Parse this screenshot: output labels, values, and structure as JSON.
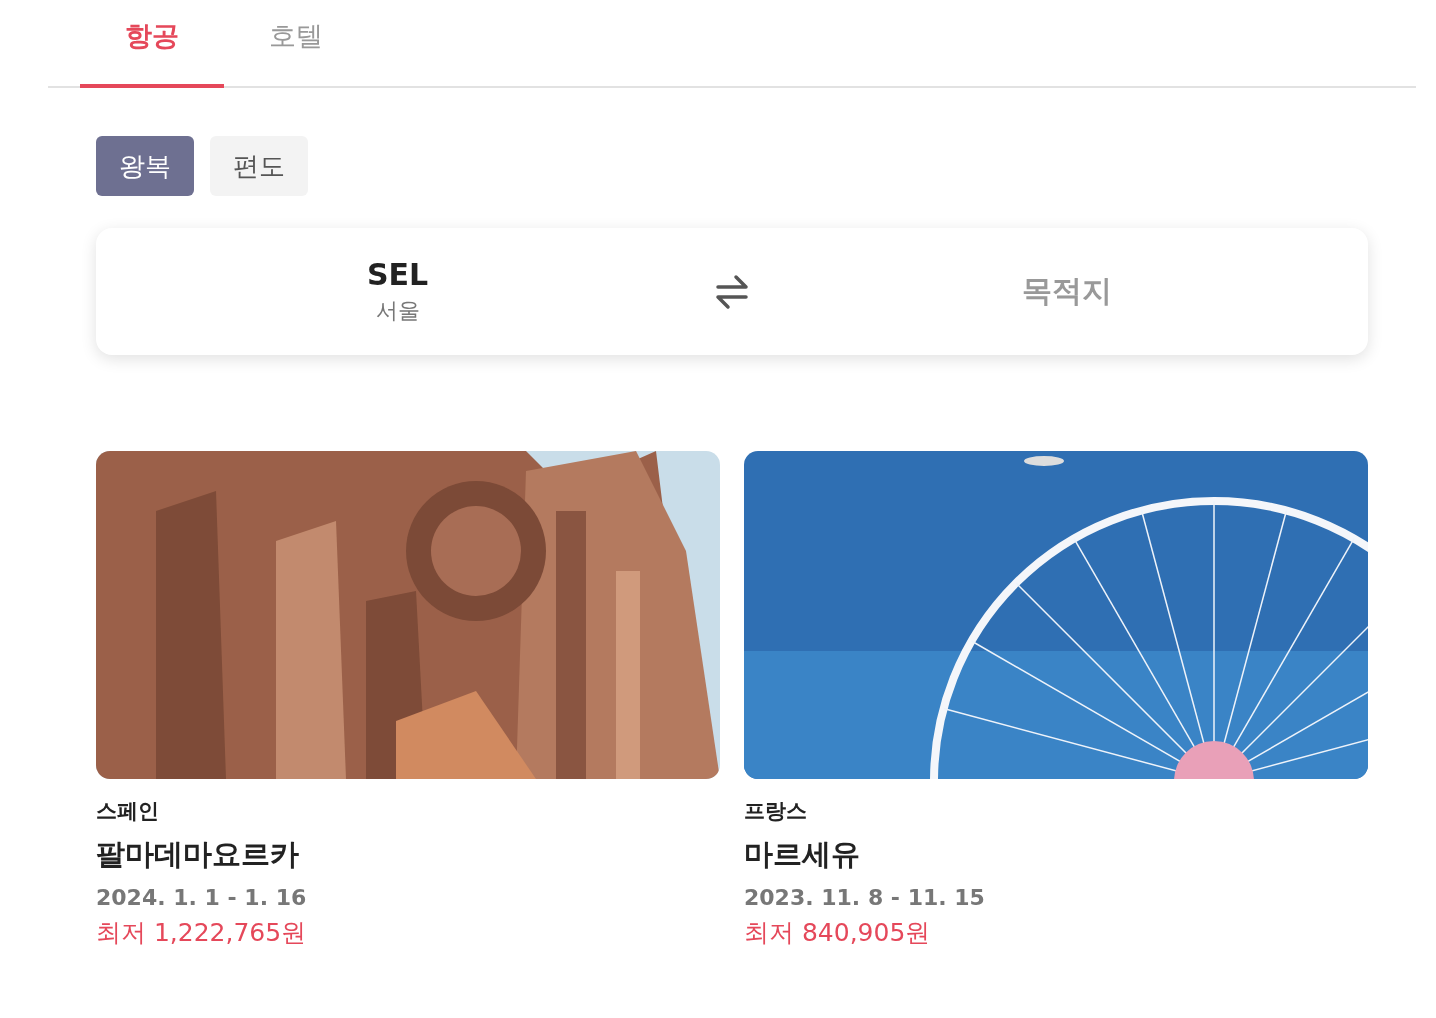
{
  "tabs": [
    {
      "label": "항공",
      "selected": true
    },
    {
      "label": "호텔",
      "selected": false
    }
  ],
  "trip_types": [
    {
      "label": "왕복",
      "selected": true
    },
    {
      "label": "편도",
      "selected": false
    }
  ],
  "route": {
    "origin": {
      "code": "SEL",
      "city": "서울"
    },
    "destination": {
      "placeholder": "목적지"
    }
  },
  "destinations": [
    {
      "country": "스페인",
      "city": "팔마데마요르카",
      "dates": "2024. 1. 1 - 1. 16",
      "price": "최저 1,222,765원"
    },
    {
      "country": "프랑스",
      "city": "마르세유",
      "dates": "2023. 11. 8 - 11. 15",
      "price": "최저 840,905원"
    }
  ]
}
